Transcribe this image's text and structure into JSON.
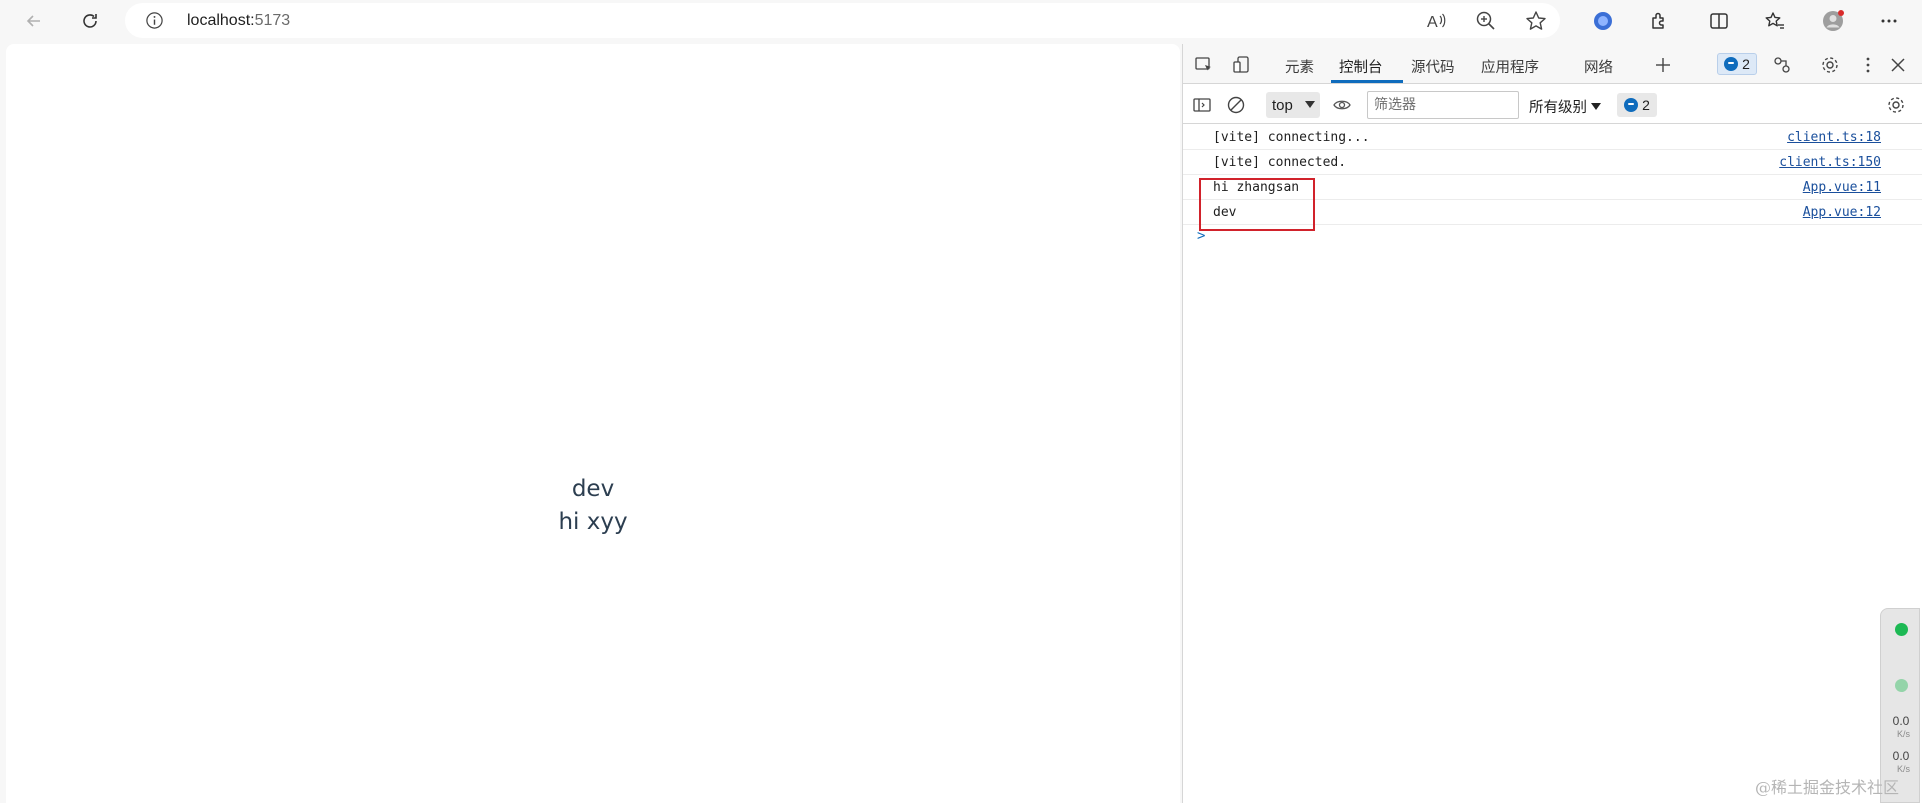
{
  "browser": {
    "url_host": "localhost:",
    "url_port": "5173"
  },
  "page": {
    "line1": "dev",
    "line2": "hi xyy"
  },
  "devtools": {
    "tabs": [
      {
        "label": "元素"
      },
      {
        "label": "控制台"
      },
      {
        "label": "源代码"
      },
      {
        "label": "应用程序"
      },
      {
        "label": "网络"
      }
    ],
    "active_tab": "控制台",
    "issues_count": "2",
    "context_select": "top",
    "filter_placeholder": "筛选器",
    "levels_label": "所有级别",
    "console_issues_count": "2",
    "logs": [
      {
        "message": "[vite] connecting...",
        "source": "client.ts:18"
      },
      {
        "message": "[vite] connected.",
        "source": "client.ts:150"
      },
      {
        "message": "hi zhangsan",
        "source": "App.vue:11"
      },
      {
        "message": "dev",
        "source": "App.vue:12"
      }
    ],
    "prompt": ">"
  },
  "perf_widget": {
    "up_value": "0.0",
    "up_unit": "K/s",
    "down_value": "0.0",
    "down_unit": "K/s"
  },
  "watermark": "@稀土掘金技术社区",
  "colors": {
    "accent": "#0f6cbd",
    "highlight": "#d1222b",
    "app_text": "#2c3e50"
  }
}
